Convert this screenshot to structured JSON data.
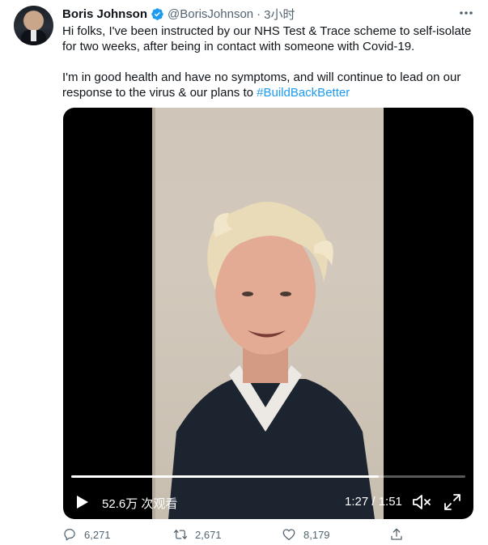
{
  "tweet": {
    "author": {
      "name": "Boris Johnson",
      "handle": "@BorisJohnson",
      "separator": "·",
      "time": "3小时",
      "verified": true
    },
    "text": {
      "paragraph1": "Hi folks, I've been instructed by our NHS Test & Trace scheme to self-isolate for two weeks, after being in contact with someone with Covid-19.",
      "paragraph2_prefix": "I'm in good health and have no symptoms, and will continue to lead on our response to the virus & our plans to ",
      "hashtag": "#BuildBackBetter"
    },
    "video": {
      "views": "52.6万 次观看",
      "time": "1:27 / 1:51",
      "progress_fraction": 0.78
    },
    "actions": {
      "replies": "6,271",
      "retweets": "2,671",
      "likes": "8,179"
    },
    "colors": {
      "accent": "#1d9bf0",
      "secondary_text": "#536471"
    },
    "icons": [
      "verified-badge-icon",
      "more-icon",
      "play-icon",
      "volume-icon",
      "fullscreen-icon",
      "reply-icon",
      "retweet-icon",
      "like-icon",
      "share-icon"
    ]
  }
}
